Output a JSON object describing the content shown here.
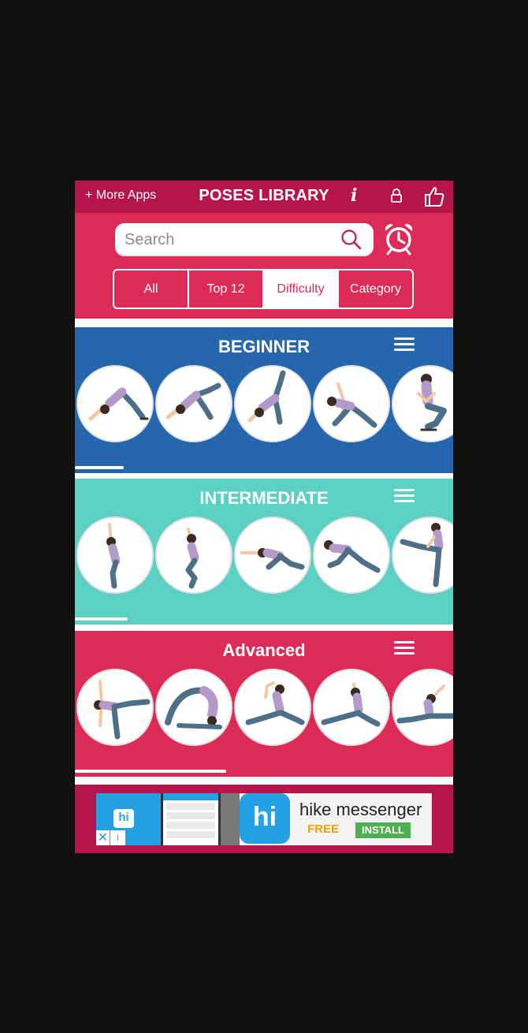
{
  "topbar": {
    "more_apps": "+ More Apps",
    "title": "POSES LIBRARY",
    "info_glyph": "i"
  },
  "search": {
    "placeholder": "Search"
  },
  "tabs": [
    "All",
    "Top 12",
    "Difficulty",
    "Category"
  ],
  "active_tab": "Difficulty",
  "sections": [
    {
      "title": "BEGINNER",
      "poses": [
        "downward-dog",
        "downward-dog-variation",
        "three-legged-dog",
        "revolved-triangle",
        "squat"
      ],
      "scroll_fraction": 0.13
    },
    {
      "title": "INTERMEDIATE",
      "poses": [
        "upward-salute",
        "eagle",
        "extended-side-angle",
        "reverse-warrior",
        "standing-split"
      ],
      "scroll_fraction": 0.14
    },
    {
      "title": "Advanced",
      "poses": [
        "half-moon",
        "bridge-wheel",
        "pigeon",
        "seated-twist",
        "splits"
      ],
      "scroll_fraction": 0.4
    }
  ],
  "ad": {
    "small_logo": "hi",
    "big_logo": "hi",
    "name": "hike messenger",
    "free": "FREE",
    "install": "INSTALL",
    "close_glyph": "✕",
    "info_glyph": "i"
  },
  "colors": {
    "topbar": "#b5154a",
    "accent": "#dc2b56",
    "beginner": "#2566ad",
    "intermediate": "#5dd0c4",
    "advanced": "#dc2b56",
    "background": "#111111"
  }
}
